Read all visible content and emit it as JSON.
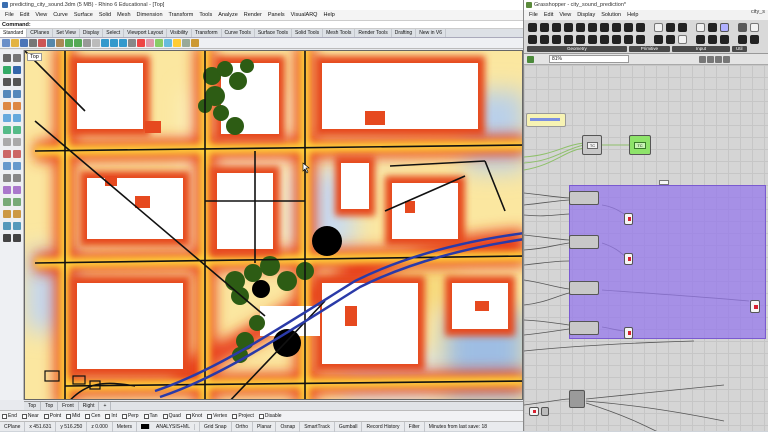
{
  "rhino": {
    "title": "predicting_city_sound.3dm (5 MB) - Rhino 6 Educational - [Top]",
    "menu": [
      "File",
      "Edit",
      "View",
      "Curve",
      "Surface",
      "Solid",
      "Mesh",
      "Dimension",
      "Transform",
      "Tools",
      "Analyze",
      "Render",
      "Panels",
      "VisualARQ",
      "Help"
    ],
    "command_label": "Command:",
    "tabs": [
      "Standard",
      "CPlanes",
      "Set View",
      "Display",
      "Select",
      "Viewport Layout",
      "Visibility",
      "Transform",
      "Curve Tools",
      "Surface Tools",
      "Solid Tools",
      "Mesh Tools",
      "Render Tools",
      "Drafting",
      "New in V6"
    ],
    "active_tab": "Standard",
    "viewport_label": "Top",
    "view_tabs": [
      "Top",
      "Top",
      "Front",
      "Right",
      "+"
    ],
    "osnaps": [
      "End",
      "Near",
      "Point",
      "Mid",
      "Cen",
      "Int",
      "Perp",
      "Tan",
      "Quad",
      "Knot",
      "Vertex",
      "Project",
      "Disable"
    ],
    "status": {
      "cplane": "CPlane",
      "x": "x 451.631",
      "y": "y 516.250",
      "z": "z 0.000",
      "units": "Meters",
      "layer": "ANALYSIS+ML",
      "items": [
        "Grid Snap",
        "Ortho",
        "Planar",
        "Osnap",
        "SmartTrack",
        "Gumball",
        "Record History",
        "Filter"
      ],
      "message": "Minutes from last save: 18"
    }
  },
  "grasshopper": {
    "title": "Grasshopper - city_sound_prediction*",
    "menu": [
      "File",
      "Edit",
      "View",
      "Display",
      "Solution",
      "Help"
    ],
    "corner_label": "city_s",
    "categories": [
      "Geometry",
      "Primitive",
      "Input",
      "Util"
    ],
    "zoom": "81%",
    "nodes": [
      "TC",
      "TC"
    ]
  },
  "colors": {
    "heat_red": "#e8401c",
    "heat_yellow": "#f9c842",
    "road_yellow": "#ffe600",
    "heat_blue": "#6f9bd6",
    "tree_green": "#2d5c14",
    "gh_group": "#9678eb",
    "gh_green": "#8ee36a"
  }
}
